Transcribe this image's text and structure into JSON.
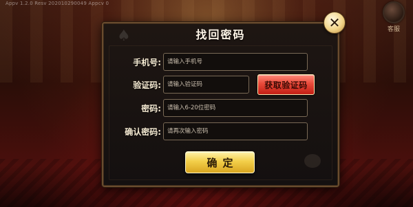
{
  "app": {
    "version_text": "Appv 1.2.0    Resv 2020102900​49    Appcv 0"
  },
  "service": {
    "label": "客服",
    "icon": "customer-service-icon"
  },
  "dialog": {
    "title": "找回密码",
    "close_icon": "close-icon",
    "fields": {
      "phone": {
        "label": "手机号:",
        "placeholder": "请输入手机号",
        "value": ""
      },
      "code": {
        "label": "验证码:",
        "placeholder": "请输入验证码",
        "value": ""
      },
      "password": {
        "label": "密码:",
        "placeholder": "请输入6-20位密码",
        "value": ""
      },
      "confirm_password": {
        "label": "确认密码:",
        "placeholder": "请再次输入密码",
        "value": ""
      }
    },
    "get_code_button": "获取验证码",
    "confirm_button": "确定"
  },
  "colors": {
    "accent_gold": "#f3cf4a",
    "accent_red": "#e84a3a",
    "dialog_border": "#6a4c2e"
  }
}
